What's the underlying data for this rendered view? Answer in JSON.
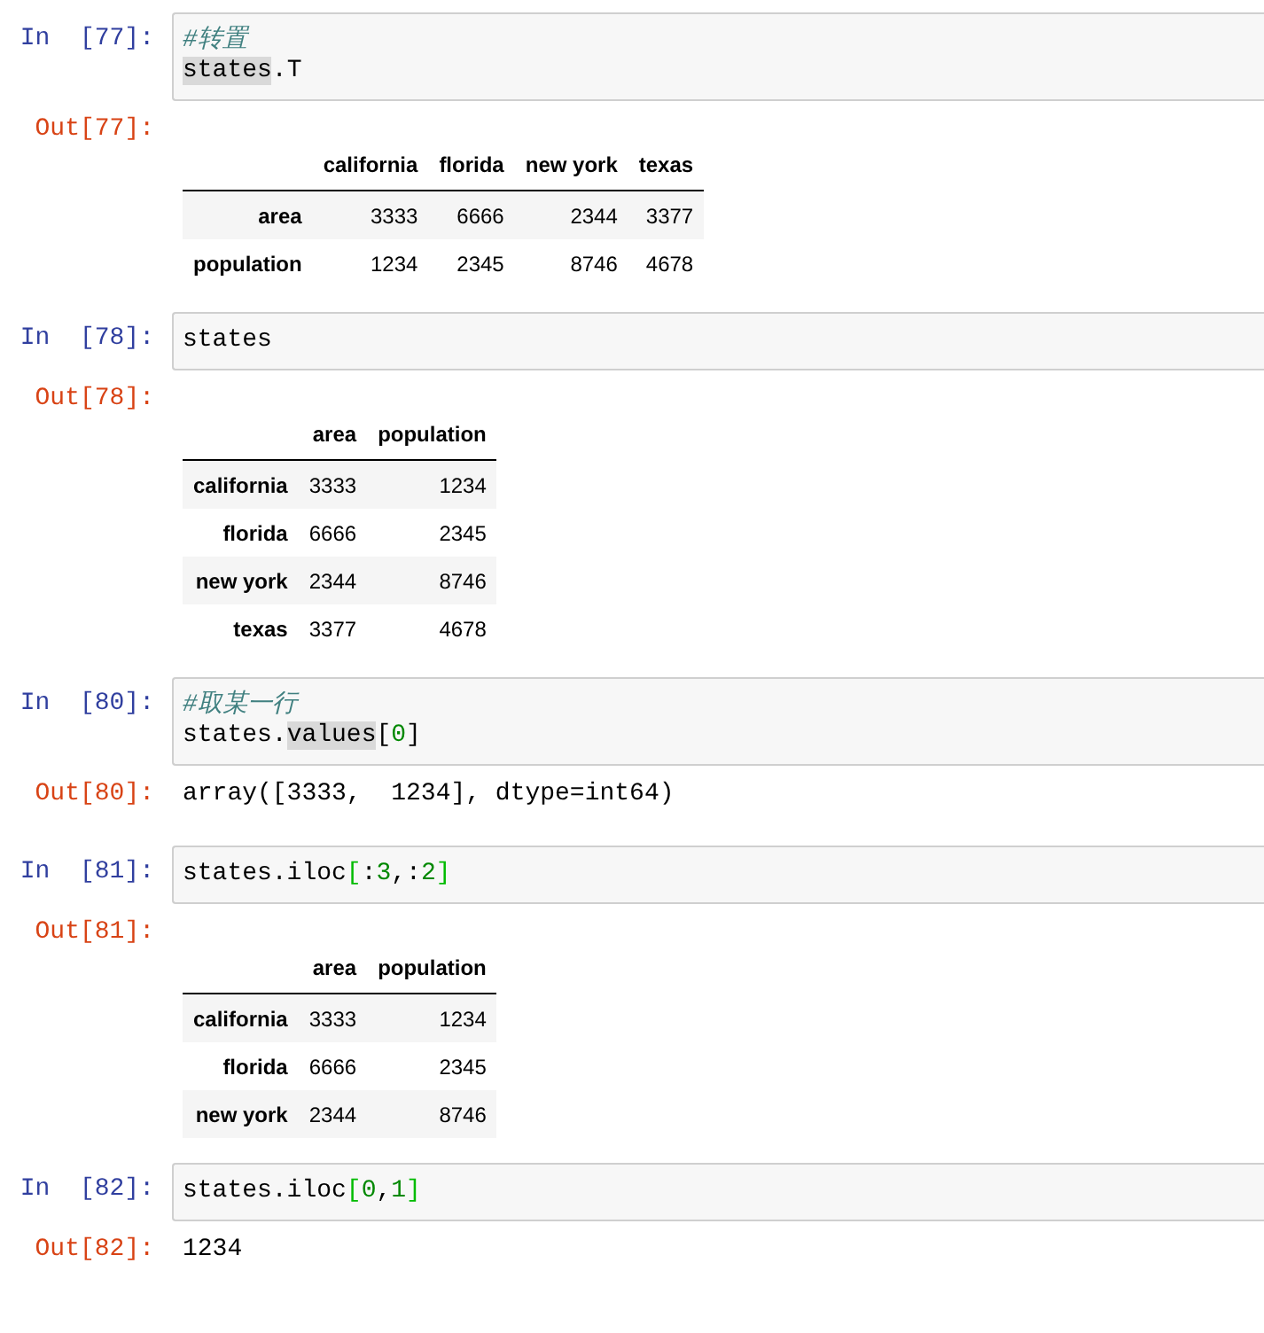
{
  "cells": [
    {
      "in_prompt": "In  [77]:",
      "code": [
        [
          {
            "kind": "comment",
            "text": "#转置"
          }
        ],
        [
          {
            "kind": "highlight",
            "text": "states"
          },
          {
            "kind": "plain",
            "text": ".T"
          }
        ]
      ],
      "output": {
        "prompt": "Out[77]:",
        "kind": "table",
        "columns": [
          "california",
          "florida",
          "new york",
          "texas"
        ],
        "rows": [
          {
            "header": "area",
            "values": [
              "3333",
              "6666",
              "2344",
              "3377"
            ]
          },
          {
            "header": "population",
            "values": [
              "1234",
              "2345",
              "8746",
              "4678"
            ]
          }
        ]
      }
    },
    {
      "in_prompt": "In  [78]:",
      "code": [
        [
          {
            "kind": "plain",
            "text": "states"
          }
        ]
      ],
      "output": {
        "prompt": "Out[78]:",
        "kind": "table",
        "columns": [
          "area",
          "population"
        ],
        "rows": [
          {
            "header": "california",
            "values": [
              "3333",
              "1234"
            ]
          },
          {
            "header": "florida",
            "values": [
              "6666",
              "2345"
            ]
          },
          {
            "header": "new york",
            "values": [
              "2344",
              "8746"
            ]
          },
          {
            "header": "texas",
            "values": [
              "3377",
              "4678"
            ]
          }
        ]
      }
    },
    {
      "in_prompt": "In  [80]:",
      "code": [
        [
          {
            "kind": "comment",
            "text": "#取某一行"
          }
        ],
        [
          {
            "kind": "plain",
            "text": "states."
          },
          {
            "kind": "highlight",
            "text": "values"
          },
          {
            "kind": "plain",
            "text": "["
          },
          {
            "kind": "number",
            "text": "0"
          },
          {
            "kind": "plain",
            "text": "]"
          }
        ]
      ],
      "output": {
        "prompt": "Out[80]:",
        "kind": "text",
        "text": "array([3333,  1234], dtype=int64)"
      }
    },
    {
      "in_prompt": "In  [81]:",
      "code": [
        [
          {
            "kind": "plain",
            "text": "states.iloc"
          },
          {
            "kind": "bracket",
            "text": "["
          },
          {
            "kind": "plain",
            "text": ":"
          },
          {
            "kind": "number",
            "text": "3"
          },
          {
            "kind": "plain",
            "text": ",:"
          },
          {
            "kind": "number",
            "text": "2"
          },
          {
            "kind": "bracket",
            "text": "]"
          }
        ]
      ],
      "output": {
        "prompt": "Out[81]:",
        "kind": "table",
        "columns": [
          "area",
          "population"
        ],
        "rows": [
          {
            "header": "california",
            "values": [
              "3333",
              "1234"
            ]
          },
          {
            "header": "florida",
            "values": [
              "6666",
              "2345"
            ]
          },
          {
            "header": "new york",
            "values": [
              "2344",
              "8746"
            ]
          }
        ]
      }
    },
    {
      "in_prompt": "In  [82]:",
      "code": [
        [
          {
            "kind": "plain",
            "text": "states.iloc"
          },
          {
            "kind": "bracket",
            "text": "["
          },
          {
            "kind": "number",
            "text": "0"
          },
          {
            "kind": "plain",
            "text": ","
          },
          {
            "kind": "number",
            "text": "1"
          },
          {
            "kind": "bracket",
            "text": "]"
          }
        ]
      ],
      "output": {
        "prompt": "Out[82]:",
        "kind": "text",
        "text": "1234"
      }
    }
  ]
}
